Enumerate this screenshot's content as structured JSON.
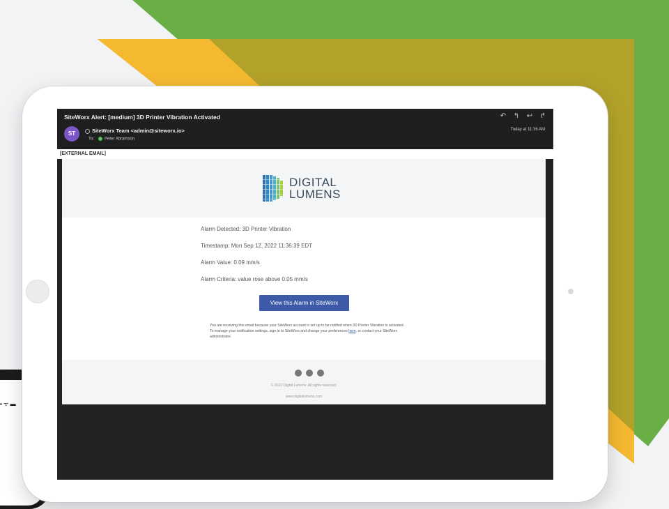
{
  "email": {
    "subject": "SiteWorx Alert: [medium] 3D Printer Vibration Activated",
    "avatar_initials": "ST",
    "sender": "SiteWorx Team <admin@siteworx.io>",
    "to_label": "To:",
    "recipient": "Peter Abramson",
    "timestamp": "Today at 11:36 AM",
    "external_notice": "[EXTERNAL EMAIL]"
  },
  "brand": {
    "logo_line1": "DIGITAL",
    "logo_line2": "LUMENS",
    "cta_color": "#3d5aa8"
  },
  "alarm": {
    "detected": "Alarm Detected: 3D Printer Vibration",
    "timestamp": "Timestamp: Mon Sep 12, 2022 11:36:39 EDT",
    "value": "Alarm Value: 0.09 mm/s",
    "criteria": "Alarm Criteria: value rose above 0.05 mm/s"
  },
  "cta": {
    "label": "View this Alarm in SiteWorx"
  },
  "notice": {
    "before_link": "You are receiving this email because your SiteWorx account is set up to be notified when 3D Printer Vibration is activated. To manage your notification settings, sign in to SiteWorx and change your preferences",
    "link": "here",
    "after_link": ", or contact your SiteWorx administrator."
  },
  "footer": {
    "copyright": "© 2022 Digital Lumens. All rights reserved.",
    "website": "www.digitallumens.com"
  },
  "icons": {
    "actions": [
      "reply-icon",
      "reply-all-icon",
      "undo-icon",
      "forward-icon"
    ],
    "social": [
      "facebook-icon",
      "twitter-icon",
      "linkedin-icon"
    ]
  },
  "background_colors": {
    "green": "#6aaf45",
    "olive": "#b3a22a",
    "yellow": "#f5b931"
  }
}
